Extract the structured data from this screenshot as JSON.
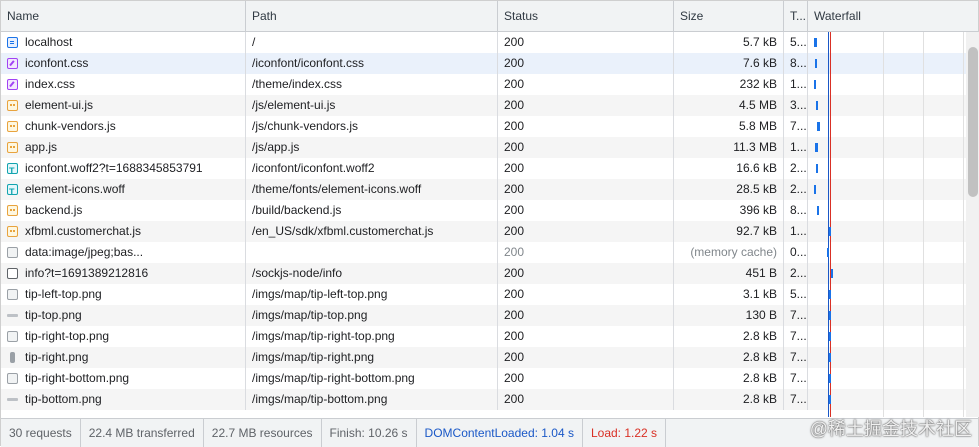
{
  "columns": {
    "name": "Name",
    "path": "Path",
    "status": "Status",
    "size": "Size",
    "time": "T...",
    "waterfall": "Waterfall"
  },
  "rows": [
    {
      "icon": "document-icon",
      "name": "localhost",
      "path": "/",
      "status": "200",
      "size": "5.7 kB",
      "time": "5..."
    },
    {
      "icon": "stylesheet-icon",
      "name": "iconfont.css",
      "path": "/iconfont/iconfont.css",
      "status": "200",
      "size": "7.6 kB",
      "time": "8..."
    },
    {
      "icon": "stylesheet-icon",
      "name": "index.css",
      "path": "/theme/index.css",
      "status": "200",
      "size": "232 kB",
      "time": "1..."
    },
    {
      "icon": "script-icon",
      "name": "element-ui.js",
      "path": "/js/element-ui.js",
      "status": "200",
      "size": "4.5 MB",
      "time": "3..."
    },
    {
      "icon": "script-icon",
      "name": "chunk-vendors.js",
      "path": "/js/chunk-vendors.js",
      "status": "200",
      "size": "5.8 MB",
      "time": "7..."
    },
    {
      "icon": "script-icon",
      "name": "app.js",
      "path": "/js/app.js",
      "status": "200",
      "size": "11.3 MB",
      "time": "1..."
    },
    {
      "icon": "font-icon",
      "name": "iconfont.woff2?t=1688345853791",
      "path": "/iconfont/iconfont.woff2",
      "status": "200",
      "size": "16.6 kB",
      "time": "2..."
    },
    {
      "icon": "font-icon",
      "name": "element-icons.woff",
      "path": "/theme/fonts/element-icons.woff",
      "status": "200",
      "size": "28.5 kB",
      "time": "2..."
    },
    {
      "icon": "script-icon",
      "name": "backend.js",
      "path": "/build/backend.js",
      "status": "200",
      "size": "396 kB",
      "time": "8..."
    },
    {
      "icon": "script-icon",
      "name": "xfbml.customerchat.js",
      "path": "/en_US/sdk/xfbml.customerchat.js",
      "status": "200",
      "size": "92.7 kB",
      "time": "1..."
    },
    {
      "icon": "image-icon",
      "name": "data:image/jpeg;bas...",
      "path": "",
      "status": "200",
      "size": "(memory cache)",
      "time": "0...",
      "muted": true
    },
    {
      "icon": "other-icon",
      "name": "info?t=1691389212816",
      "path": "/sockjs-node/info",
      "status": "200",
      "size": "451 B",
      "time": "2..."
    },
    {
      "icon": "image-icon",
      "name": "tip-left-top.png",
      "path": "/imgs/map/tip-left-top.png",
      "status": "200",
      "size": "3.1 kB",
      "time": "5..."
    },
    {
      "icon": "image-line-icon",
      "name": "tip-top.png",
      "path": "/imgs/map/tip-top.png",
      "status": "200",
      "size": "130 B",
      "time": "7..."
    },
    {
      "icon": "image-icon",
      "name": "tip-right-top.png",
      "path": "/imgs/map/tip-right-top.png",
      "status": "200",
      "size": "2.8 kB",
      "time": "7..."
    },
    {
      "icon": "image-bar-icon",
      "name": "tip-right.png",
      "path": "/imgs/map/tip-right.png",
      "status": "200",
      "size": "2.8 kB",
      "time": "7..."
    },
    {
      "icon": "image-icon",
      "name": "tip-right-bottom.png",
      "path": "/imgs/map/tip-right-bottom.png",
      "status": "200",
      "size": "2.8 kB",
      "time": "7..."
    },
    {
      "icon": "image-line-icon",
      "name": "tip-bottom.png",
      "path": "/imgs/map/tip-bottom.png",
      "status": "200",
      "size": "2.8 kB",
      "time": "7..."
    }
  ],
  "footer": {
    "requests": "30 requests",
    "transferred": "22.4 MB transferred",
    "resources": "22.7 MB resources",
    "finish": "Finish: 10.26 s",
    "dom_content_loaded": "DOMContentLoaded: 1.04 s",
    "load": "Load: 1.22 s"
  },
  "watermark": "@稀土掘金技术社区",
  "colors": {
    "dom_content_loaded": "#1a58c7",
    "load": "#d93025",
    "waterfall_bar": "#1a73e8"
  }
}
